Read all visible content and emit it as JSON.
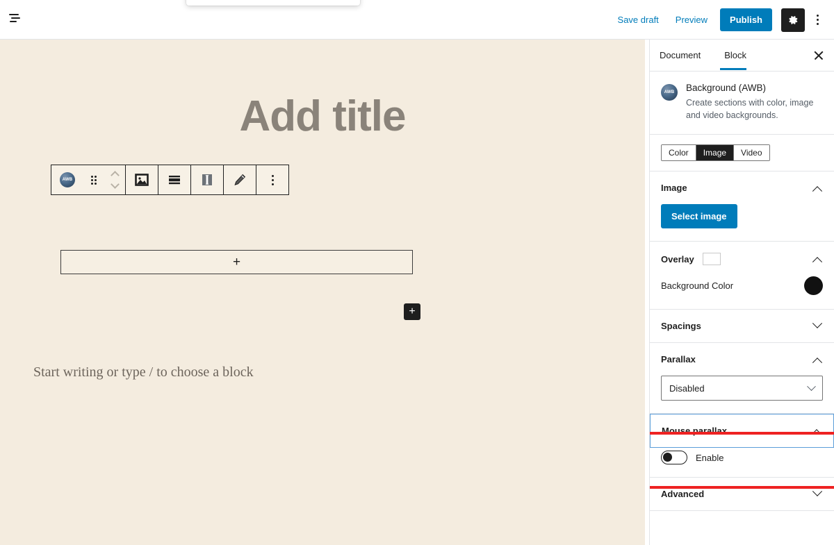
{
  "topbar": {
    "outline_icon": "document-outline-icon",
    "save_draft": "Save draft",
    "preview": "Preview",
    "publish": "Publish",
    "settings_icon": "gear-icon",
    "more_icon": "kebab-menu-icon"
  },
  "canvas": {
    "title_placeholder": "Add title",
    "appender_plus": "+",
    "add_block_plus": "+",
    "paragraph_placeholder": "Start writing or type / to choose a block",
    "background_color": "#f4ecdf"
  },
  "block_toolbar": {
    "block_icon_label": "AWB",
    "items": [
      {
        "name": "block-type-awb-icon",
        "label": "AWB"
      },
      {
        "name": "drag-handle-icon",
        "label": ""
      },
      {
        "name": "move-up-down-icon",
        "label": ""
      },
      {
        "name": "image-icon",
        "label": ""
      },
      {
        "name": "align-icon",
        "label": ""
      },
      {
        "name": "vertical-align-icon",
        "label": ""
      },
      {
        "name": "edit-pencil-icon",
        "label": ""
      },
      {
        "name": "more-options-icon",
        "label": ""
      }
    ]
  },
  "sidebar": {
    "tabs": [
      {
        "label": "Document",
        "active": false
      },
      {
        "label": "Block",
        "active": true
      }
    ],
    "close_label": "×",
    "block_card": {
      "icon_label": "AWB",
      "title": "Background (AWB)",
      "description": "Create sections with color, image and video backgrounds."
    },
    "type_segments": [
      {
        "label": "Color",
        "active": false
      },
      {
        "label": "Image",
        "active": true
      },
      {
        "label": "Video",
        "active": false
      }
    ],
    "image_panel": {
      "title": "Image",
      "expanded": true,
      "select_image_button": "Select image"
    },
    "overlay_panel": {
      "title": "Overlay",
      "expanded": true,
      "swatch_color": "#ffffff",
      "background_color_label": "Background Color",
      "background_color_value": "#111111"
    },
    "spacings_panel": {
      "title": "Spacings",
      "expanded": false
    },
    "parallax_panel": {
      "title": "Parallax",
      "expanded": true,
      "select_value": "Disabled"
    },
    "mouse_parallax_panel": {
      "title": "Mouse parallax",
      "expanded": true,
      "toggle_label": "Enable",
      "toggle_on": false,
      "highlighted": true,
      "highlight_color": "#ee2222"
    },
    "advanced_panel": {
      "title": "Advanced",
      "expanded": false
    }
  },
  "colors": {
    "accent": "#007cba",
    "canvas_bg": "#f4ecdf",
    "dark": "#1e1e1e",
    "annotation_red": "#ee2222"
  }
}
